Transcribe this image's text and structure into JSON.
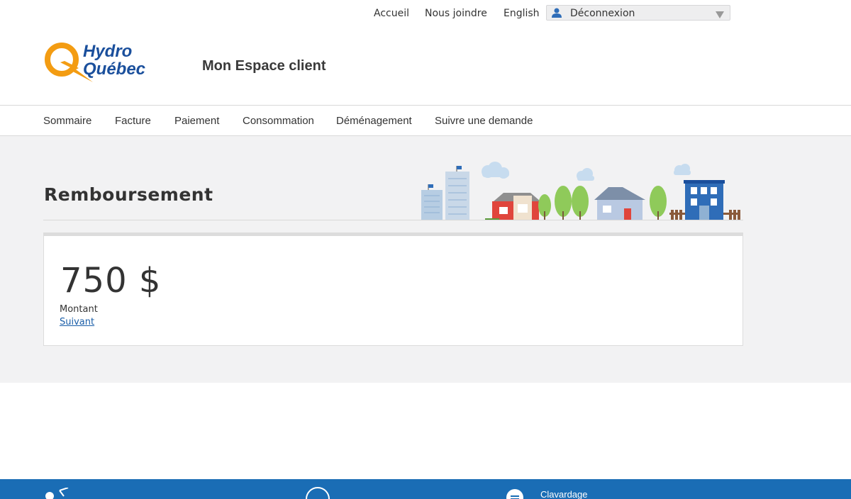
{
  "utility": {
    "home": "Accueil",
    "contact": "Nous joindre",
    "language": "English",
    "user_menu_label": "Déconnexion"
  },
  "header": {
    "logo_line1": "Hydro",
    "logo_line2": "Québec",
    "site_title": "Mon Espace client"
  },
  "nav": [
    "Sommaire",
    "Facture",
    "Paiement",
    "Consommation",
    "Déménagement",
    "Suivre une demande"
  ],
  "page": {
    "title": "Remboursement",
    "amount": "750 $",
    "amount_label": "Montant",
    "next_link": "Suivant"
  },
  "footer": {
    "chat_label": "Clavardage"
  },
  "colors": {
    "brand_orange": "#f39c12",
    "brand_blue": "#1a4f9c",
    "footer_blue": "#1a6db5",
    "link_blue": "#1a5ea8"
  }
}
